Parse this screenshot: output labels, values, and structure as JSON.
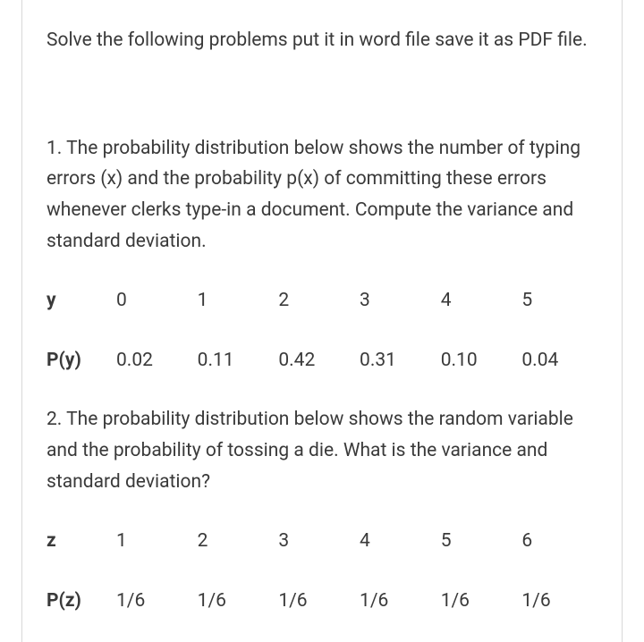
{
  "intro": "Solve the following problems put it in word file save it as PDF file.",
  "problem1": {
    "text": "1. The probability distribution below shows the number of typing errors (x) and the probability p(x) of committing these errors whenever clerks type-in a document. Compute the variance and standard deviation.",
    "headerLabel": "y",
    "header": [
      "0",
      "1",
      "2",
      "3",
      "4",
      "5"
    ],
    "probLabel": "P(y)",
    "prob": [
      "0.02",
      "0.11",
      "0.42",
      "0.31",
      "0.10",
      "0.04"
    ]
  },
  "problem2": {
    "text": "2. The probability distribution below shows the random variable and the probability of tossing a die. What is the variance and standard deviation?",
    "headerLabel": "z",
    "header": [
      "1",
      "2",
      "3",
      "4",
      "5",
      "6"
    ],
    "probLabel": "P(z)",
    "prob": [
      "1/6",
      "1/6",
      "1/6",
      "1/6",
      "1/6",
      "1/6"
    ]
  }
}
